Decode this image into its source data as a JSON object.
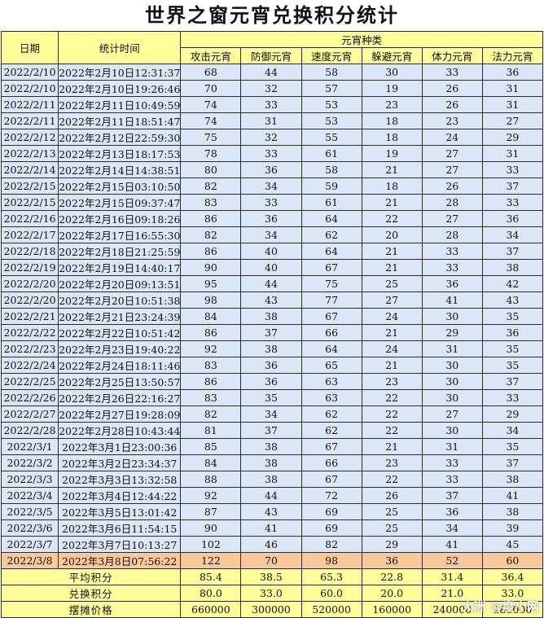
{
  "title": "世界之窗元宵兑换积分统计",
  "headers": {
    "date": "日期",
    "time": "统计时间",
    "group": "元宵种类",
    "types": [
      "攻击元宵",
      "防御元宵",
      "速度元宵",
      "躲避元宵",
      "体力元宵",
      "法力元宵"
    ]
  },
  "rows": [
    [
      "2022/2/10",
      "2022年2月10日12:31:37",
      "68",
      "44",
      "58",
      "30",
      "33",
      "36"
    ],
    [
      "2022/2/10",
      "2022年2月10日19:26:46",
      "70",
      "32",
      "57",
      "19",
      "26",
      "31"
    ],
    [
      "2022/2/11",
      "2022年2月11日10:49:59",
      "74",
      "33",
      "53",
      "23",
      "26",
      "31"
    ],
    [
      "2022/2/11",
      "2022年2月11日18:51:47",
      "74",
      "31",
      "53",
      "18",
      "23",
      "27"
    ],
    [
      "2022/2/12",
      "2022年2月12日22:59:30",
      "75",
      "32",
      "55",
      "18",
      "24",
      "29"
    ],
    [
      "2022/2/13",
      "2022年2月13日18:17:53",
      "78",
      "33",
      "61",
      "19",
      "27",
      "31"
    ],
    [
      "2022/2/14",
      "2022年2月14日14:38:51",
      "80",
      "36",
      "58",
      "21",
      "27",
      "33"
    ],
    [
      "2022/2/15",
      "2022年2月15日03:10:50",
      "82",
      "34",
      "59",
      "18",
      "26",
      "37"
    ],
    [
      "2022/2/15",
      "2022年2月15日09:37:47",
      "83",
      "33",
      "61",
      "21",
      "28",
      "33"
    ],
    [
      "2022/2/16",
      "2022年2月16日09:18:26",
      "86",
      "36",
      "64",
      "22",
      "27",
      "36"
    ],
    [
      "2022/2/17",
      "2022年2月17日16:55:30",
      "82",
      "34",
      "62",
      "20",
      "28",
      "34"
    ],
    [
      "2022/2/18",
      "2022年2月18日21:25:59",
      "86",
      "40",
      "64",
      "21",
      "33",
      "37"
    ],
    [
      "2022/2/19",
      "2022年2月19日14:40:17",
      "90",
      "40",
      "67",
      "21",
      "33",
      "38"
    ],
    [
      "2022/2/20",
      "2022年2月20日09:13:51",
      "95",
      "44",
      "75",
      "25",
      "36",
      "42"
    ],
    [
      "2022/2/20",
      "2022年2月20日10:51:38",
      "98",
      "43",
      "77",
      "27",
      "41",
      "43"
    ],
    [
      "2022/2/21",
      "2022年2月21日23:24:39",
      "84",
      "38",
      "67",
      "24",
      "30",
      "35"
    ],
    [
      "2022/2/22",
      "2022年2月22日10:51:42",
      "86",
      "37",
      "66",
      "21",
      "29",
      "36"
    ],
    [
      "2022/2/23",
      "2022年2月23日19:40:22",
      "92",
      "38",
      "64",
      "24",
      "31",
      "35"
    ],
    [
      "2022/2/24",
      "2022年2月24日18:11:46",
      "83",
      "36",
      "65",
      "21",
      "30",
      "35"
    ],
    [
      "2022/2/25",
      "2022年2月25日13:50:57",
      "86",
      "36",
      "63",
      "23",
      "30",
      "37"
    ],
    [
      "2022/2/26",
      "2022年2月26日22:16:27",
      "83",
      "35",
      "63",
      "22",
      "30",
      "33"
    ],
    [
      "2022/2/27",
      "2022年2月27日19:28:09",
      "82",
      "34",
      "62",
      "22",
      "27",
      "29"
    ],
    [
      "2022/2/28",
      "2022年2月28日10:43:44",
      "81",
      "37",
      "62",
      "22",
      "30",
      "34"
    ],
    [
      "2022/3/1",
      "2022年3月1日23:00:36",
      "85",
      "38",
      "67",
      "21",
      "31",
      "35"
    ],
    [
      "2022/3/2",
      "2022年3月2日23:34:37",
      "84",
      "38",
      "66",
      "23",
      "33",
      "37"
    ],
    [
      "2022/3/3",
      "2022年3月3日13:32:58",
      "88",
      "38",
      "67",
      "22",
      "33",
      "38"
    ],
    [
      "2022/3/4",
      "2022年3月4日12:44:22",
      "92",
      "44",
      "72",
      "26",
      "37",
      "41"
    ],
    [
      "2022/3/5",
      "2022年3月5日13:01:42",
      "87",
      "43",
      "69",
      "25",
      "36",
      "38"
    ],
    [
      "2022/3/6",
      "2022年3月6日11:54:15",
      "90",
      "41",
      "69",
      "25",
      "34",
      "39"
    ],
    [
      "2022/3/7",
      "2022年3月7日10:13:27",
      "102",
      "46",
      "82",
      "29",
      "41",
      "45"
    ],
    [
      "2022/3/8",
      "2022年3月8日07:56:22",
      "122",
      "70",
      "98",
      "36",
      "52",
      "60"
    ]
  ],
  "highlight_row_index": 30,
  "footer": [
    {
      "label": "平均积分",
      "values": [
        "85.4",
        "38.5",
        "65.3",
        "22.8",
        "31.4",
        "36.4"
      ]
    },
    {
      "label": "兑换积分",
      "values": [
        "80.0",
        "33.0",
        "60.0",
        "20.0",
        "21.0",
        "33.0"
      ]
    },
    {
      "label": "摆摊价格",
      "values": [
        "660000",
        "300000",
        "520000",
        "160000",
        "240000",
        "280000"
      ]
    }
  ],
  "watermark": "大洲 @度小网",
  "colors": {
    "header_bg": "#ffff99",
    "row_bg": "#dbe7f7",
    "highlight_bg": "#f9c89b",
    "border": "#2b2b2b"
  }
}
